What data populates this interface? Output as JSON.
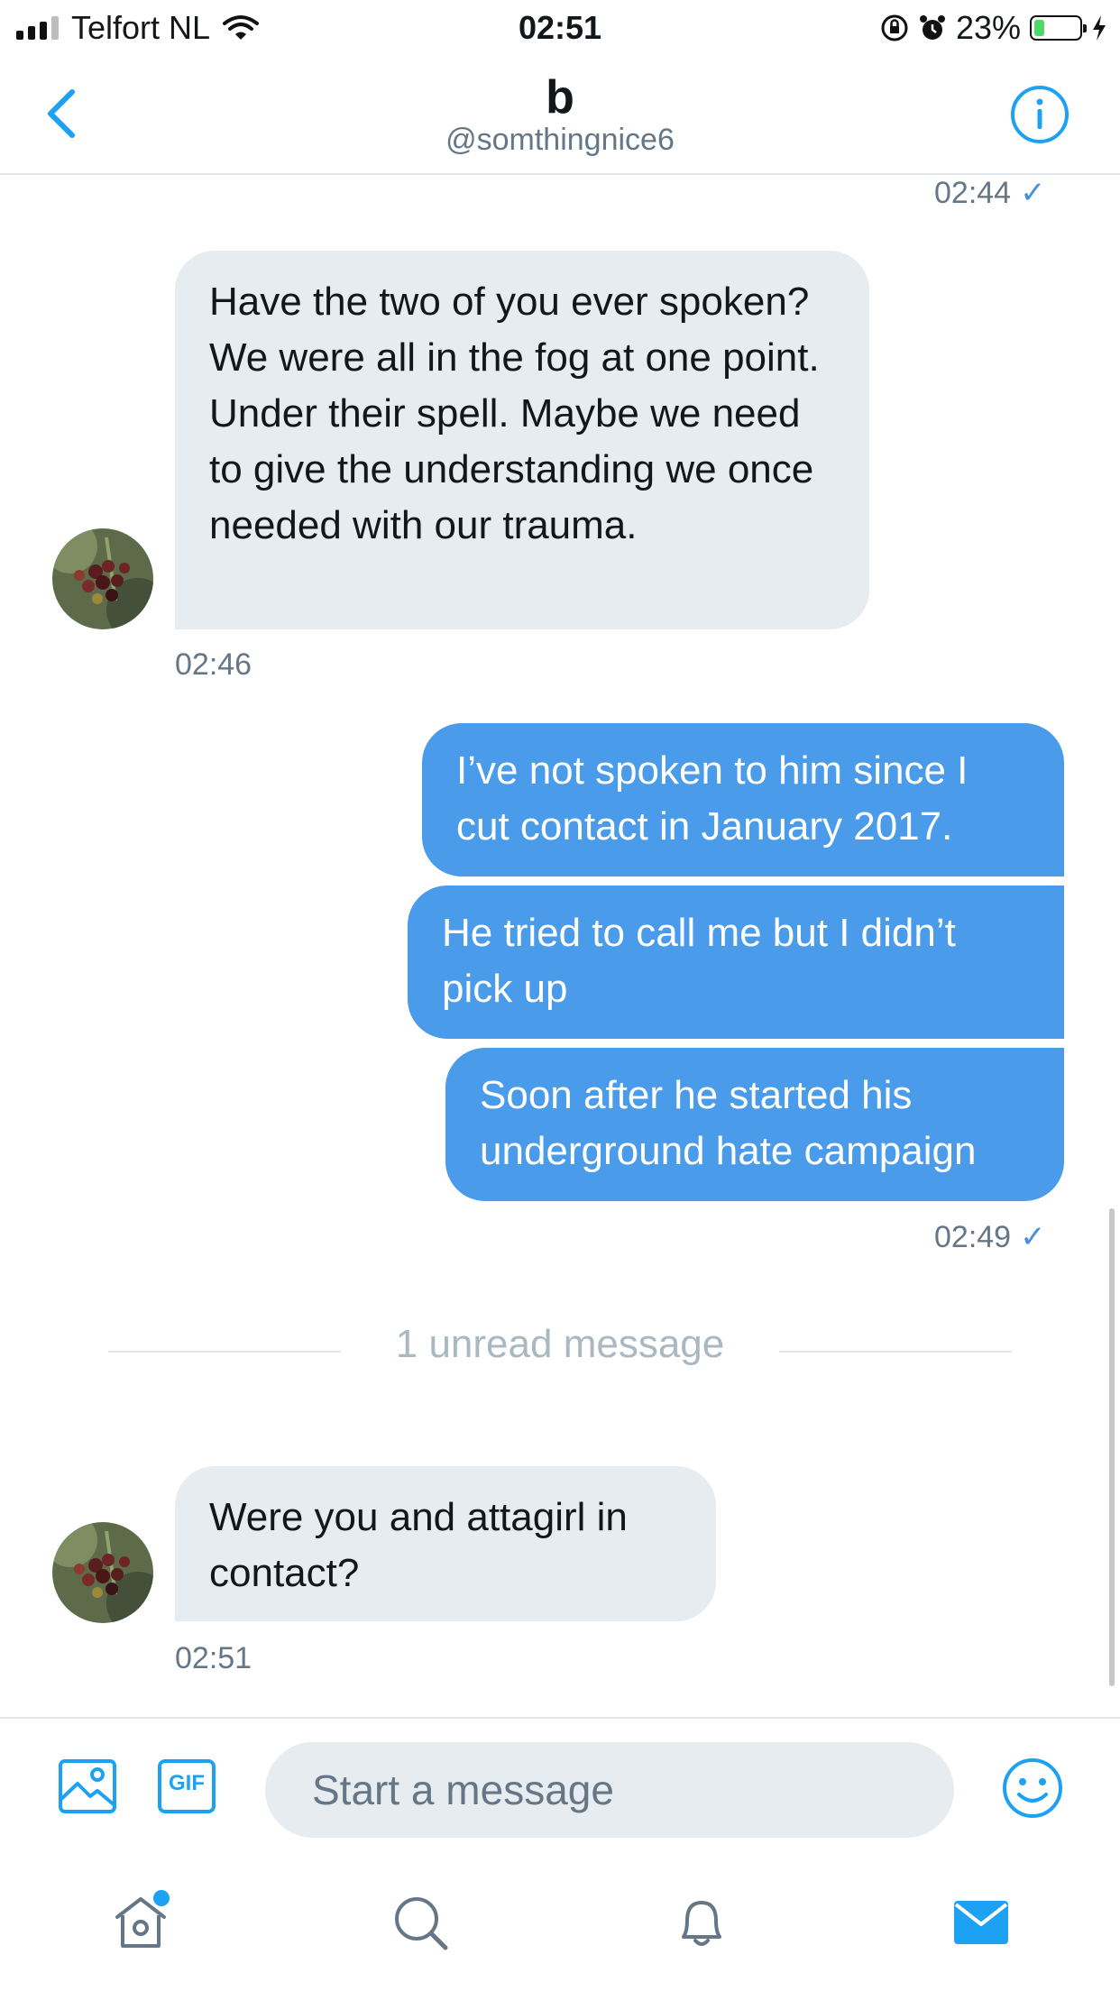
{
  "status_bar": {
    "carrier": "Telfort NL",
    "time": "02:51",
    "battery_percent": "23%",
    "battery_level": 0.23
  },
  "header": {
    "name": "b",
    "handle": "@somthingnice6"
  },
  "messages": {
    "top_timestamp": "02:44",
    "incoming_1": {
      "text": "Have the two of you ever spoken? We were all in the fog at one point. Under their spell. Maybe we need to give the understanding we once needed with our trauma.",
      "time": "02:46"
    },
    "outgoing": [
      {
        "text": "I’ve not spoken to him since I cut contact in January 2017."
      },
      {
        "text": "He tried to call me but I didn’t pick up"
      },
      {
        "text": "Soon after he started his underground hate campaign"
      }
    ],
    "outgoing_time": "02:49",
    "unread_divider": "1 unread message",
    "incoming_2": {
      "text": "Were you and attagirl in contact?",
      "time": "02:51"
    }
  },
  "composer": {
    "placeholder": "Start a message",
    "gif_label": "GIF"
  },
  "colors": {
    "accent": "#1da1f2",
    "outgoing_bubble": "#4a9ceb",
    "incoming_bubble": "#e6ecf0"
  },
  "icons": [
    "back-chevron-icon",
    "info-icon",
    "image-icon",
    "gif-icon",
    "emoji-icon",
    "home-icon",
    "search-icon",
    "bell-icon",
    "mail-icon"
  ]
}
